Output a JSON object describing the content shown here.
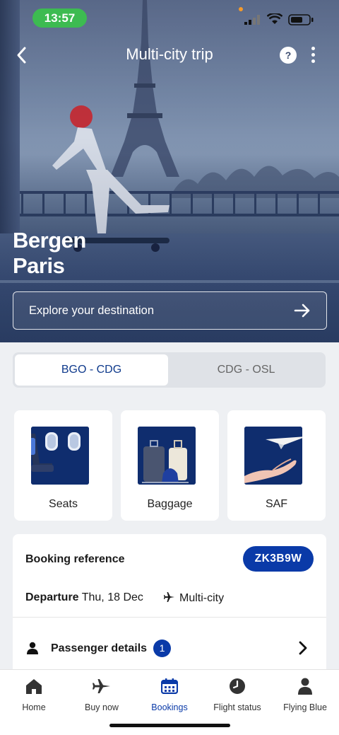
{
  "status_bar": {
    "time": "13:57"
  },
  "header": {
    "title": "Multi-city trip",
    "help_glyph": "?"
  },
  "hero": {
    "destination_line1": "Bergen",
    "destination_line2": "Paris",
    "explore_label": "Explore your destination"
  },
  "segments": {
    "items": [
      "BGO - CDG",
      "CDG - OSL"
    ],
    "selected": "BGO - CDG"
  },
  "services": [
    {
      "label": "Seats",
      "icon": "seats-icon"
    },
    {
      "label": "Baggage",
      "icon": "baggage-icon"
    },
    {
      "label": "SAF",
      "icon": "saf-icon"
    }
  ],
  "booking": {
    "reference_label": "Booking reference",
    "reference_code": "ZK3B9W",
    "departure_label": "Departure",
    "departure_date": "Thu, 18 Dec",
    "trip_type": "Multi-city",
    "passenger_label": "Passenger details",
    "passenger_count": "1"
  },
  "tabbar": {
    "items": [
      {
        "label": "Home",
        "icon": "home-icon"
      },
      {
        "label": "Buy now",
        "icon": "plane-icon"
      },
      {
        "label": "Bookings",
        "icon": "calendar-icon"
      },
      {
        "label": "Flight status",
        "icon": "clock-icon"
      },
      {
        "label": "Flying Blue",
        "icon": "person-icon"
      }
    ],
    "active": "Bookings"
  },
  "colors": {
    "brand_blue": "#0a3aa8",
    "time_pill": "#3dbb51",
    "background": "#eef0f3"
  }
}
